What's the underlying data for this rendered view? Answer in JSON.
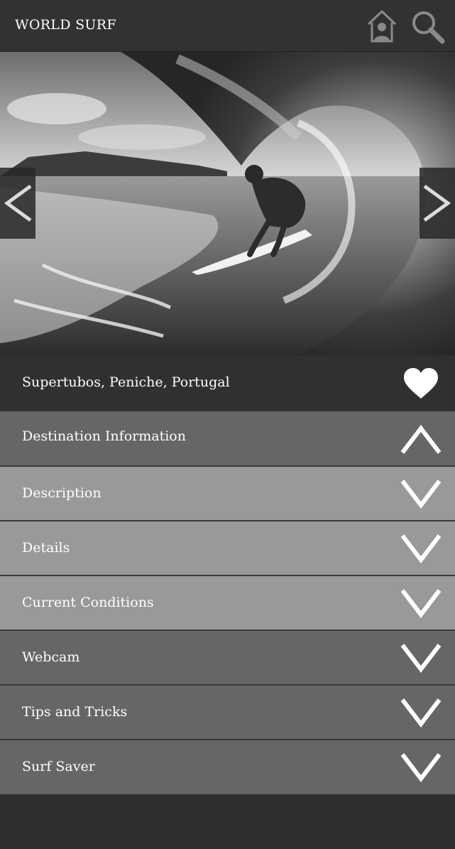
{
  "header": {
    "title": "WORLD SURF",
    "home_icon": "home-person-icon",
    "search_icon": "search-icon"
  },
  "hero": {
    "image": "surfer riding inside a wave barrel (grayscale photo)",
    "prev_icon": "chevron-left-icon",
    "next_icon": "chevron-right-icon"
  },
  "location": {
    "name": "Supertubos, Peniche, Portugal",
    "favorite_icon": "heart-icon"
  },
  "sections": [
    {
      "label": "Destination Information",
      "state": "expanded",
      "icon": "chevron-up-icon"
    },
    {
      "label": "Description",
      "state": "collapsed",
      "icon": "chevron-down-icon"
    },
    {
      "label": "Details",
      "state": "collapsed",
      "icon": "chevron-down-icon"
    },
    {
      "label": "Current Conditions",
      "state": "collapsed",
      "icon": "chevron-down-icon"
    },
    {
      "label": "Webcam",
      "state": "collapsed",
      "icon": "chevron-down-icon"
    },
    {
      "label": "Tips and Tricks",
      "state": "collapsed",
      "icon": "chevron-down-icon"
    },
    {
      "label": "Surf Saver",
      "state": "collapsed",
      "icon": "chevron-down-icon"
    }
  ],
  "colors": {
    "header_bg": "#323232",
    "section_dark": "#666666",
    "section_light": "#999999",
    "text": "#ffffff"
  }
}
